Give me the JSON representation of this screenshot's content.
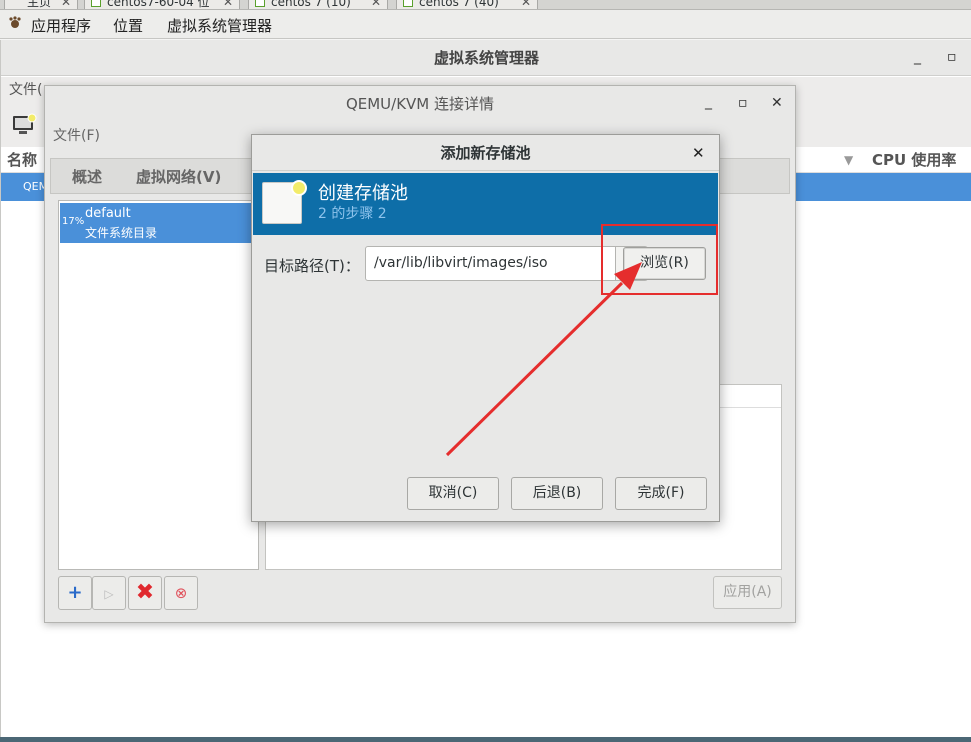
{
  "vm_tabs": [
    {
      "label": "主页"
    },
    {
      "label": "centos7-60-04 位"
    },
    {
      "label": "centos 7 (10)"
    },
    {
      "label": "centos 7 (40)"
    }
  ],
  "topbar": {
    "apps": "应用程序",
    "places": "位置",
    "vmm": "虚拟系统管理器"
  },
  "manager": {
    "title": "虚拟系统管理器",
    "menu_partial": "文件(",
    "col_name": "名称",
    "col_cpu": "CPU 使用率",
    "row_label": "QEM"
  },
  "conn_dialog": {
    "title": "QEMU/KVM 连接详情",
    "menu_file": "文件(F)",
    "tab_overview": "概述",
    "tab_vnet": "虚拟网络(V)",
    "pool": {
      "percent": "17%",
      "name": "default",
      "type": "文件系统目录"
    },
    "apply": "应用(A)"
  },
  "add_pool": {
    "title": "添加新存储池",
    "header_title": "创建存储池",
    "header_step": "2 的步骤 2",
    "target_label": "目标路径(T)：",
    "target_value": "/var/lib/libvirt/images/iso",
    "browse": "浏览(R)",
    "cancel": "取消(C)",
    "back": "后退(B)",
    "finish": "完成(F)"
  },
  "colors": {
    "selection": "#4a90d9",
    "header_blue": "#0e6ea8",
    "annotation_red": "#e52d2d"
  }
}
